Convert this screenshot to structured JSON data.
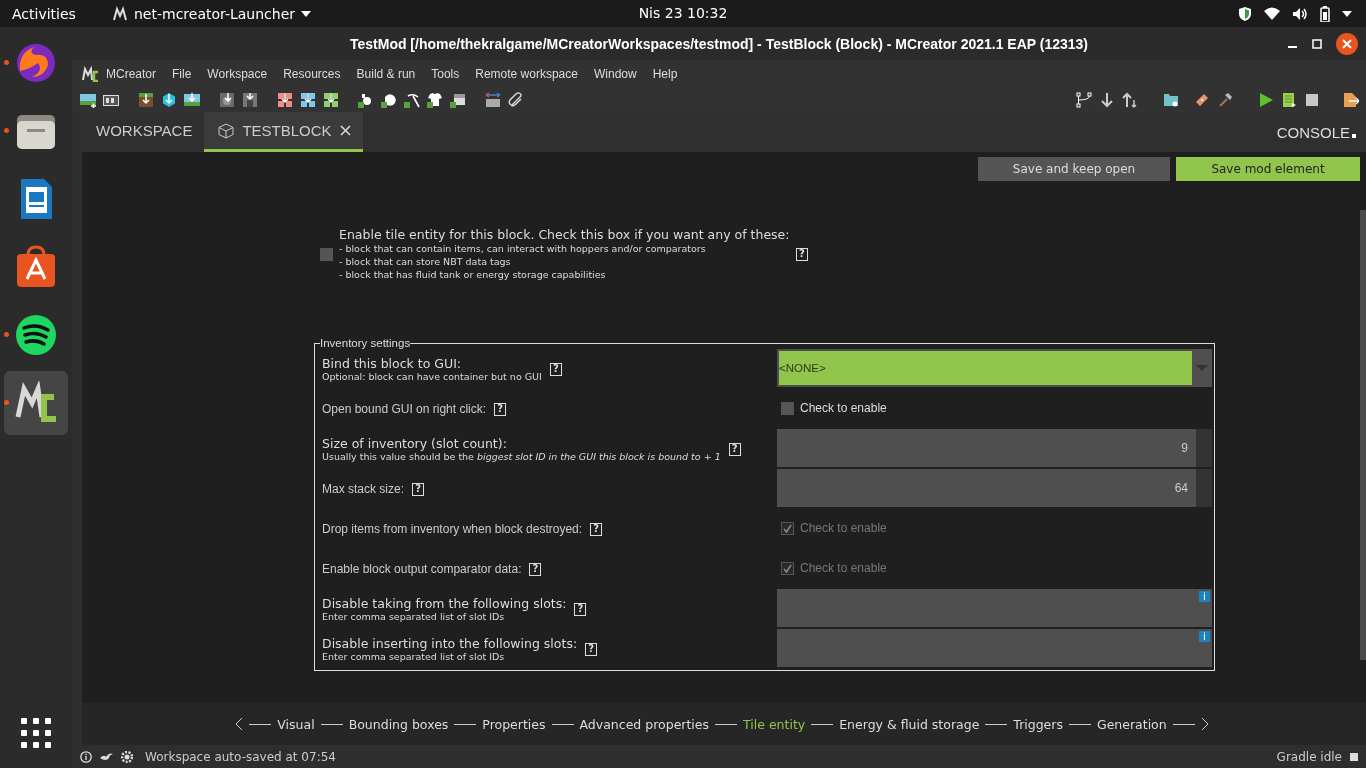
{
  "top_bar": {
    "activities": "Activities",
    "app_menu": "net-mcreator-Launcher",
    "clock": "Nis 23  10:32"
  },
  "dock": [
    {
      "kind": "browser",
      "running": true,
      "selected": false
    },
    {
      "kind": "files",
      "running": true,
      "selected": false
    },
    {
      "kind": "writer",
      "running": false,
      "selected": false
    },
    {
      "kind": "store",
      "running": false,
      "selected": false
    },
    {
      "kind": "music",
      "running": true,
      "selected": false
    },
    {
      "kind": "mcreator",
      "running": true,
      "selected": true
    }
  ],
  "window": {
    "title": "TestMod [/home/thekralgame/MCreatorWorkspaces/testmod] - TestBlock (Block) - MCreator 2021.1 EAP (12313)"
  },
  "menu": [
    "MCreator",
    "File",
    "Workspace",
    "Resources",
    "Build & run",
    "Tools",
    "Remote workspace",
    "Window",
    "Help"
  ],
  "tabs": [
    {
      "label": "WORKSPACE",
      "selected": false,
      "closable": false
    },
    {
      "label": "TESTBLOCK",
      "selected": true,
      "closable": true
    }
  ],
  "console_tab": "CONSOLE",
  "actions": [
    {
      "label": "Save and keep open",
      "kind": "secondary"
    },
    {
      "label": "Save mod element",
      "kind": "primary"
    }
  ],
  "tile_entity": {
    "checked": false,
    "title": "Enable tile entity for this block. Check this box if you want any of these:",
    "lines": [
      "- block that can contain items, can interact with hoppers and/or comparators",
      "- block that can store NBT data tags",
      "- block that has fluid tank or energy storage capabilities"
    ],
    "help": "?"
  },
  "inventory": {
    "legend": "Inventory settings",
    "rows": [
      {
        "label": "Bind this block to GUI:",
        "hint": "Optional: block can have container but no GUI",
        "help": "?",
        "kind": "dropdown",
        "value": "<NONE>"
      },
      {
        "label": "Open bound GUI on right click:",
        "help": "?",
        "kind": "checkbox",
        "text": "Check to enable",
        "checked": false,
        "disabled": false
      },
      {
        "label": "Size of inventory (slot count):",
        "hint": "Usually this value should be the *biggest slot ID in the GUI this block is bound to + 1*",
        "help": "?",
        "kind": "number",
        "value": "9"
      },
      {
        "label": "Max stack size:",
        "help": "?",
        "kind": "number",
        "value": "64"
      },
      {
        "label": "Drop items from inventory when block destroyed:",
        "help": "?",
        "kind": "checkbox",
        "text": "Check to enable",
        "checked": true,
        "disabled": true
      },
      {
        "label": "Enable block output comparator data:",
        "help": "?",
        "kind": "checkbox",
        "text": "Check to enable",
        "checked": true,
        "disabled": true
      },
      {
        "label": "Disable taking from the following slots:",
        "hint": "Enter comma separated list of slot IDs",
        "help": "?",
        "kind": "text",
        "info": "i"
      },
      {
        "label": "Disable inserting into the following slots:",
        "hint": "Enter comma separated list of slot IDs",
        "help": "?",
        "kind": "text",
        "info": "i"
      }
    ]
  },
  "pages": [
    {
      "label": "Visual",
      "selected": false
    },
    {
      "label": "Bounding boxes",
      "selected": false
    },
    {
      "label": "Properties",
      "selected": false
    },
    {
      "label": "Advanced properties",
      "selected": false
    },
    {
      "label": "Tile entity",
      "selected": true
    },
    {
      "label": "Energy & fluid storage",
      "selected": false
    },
    {
      "label": "Triggers",
      "selected": false
    },
    {
      "label": "Generation",
      "selected": false
    }
  ],
  "status_bar": {
    "message": "Workspace auto-saved at 07:54",
    "gradle": "Gradle idle"
  }
}
